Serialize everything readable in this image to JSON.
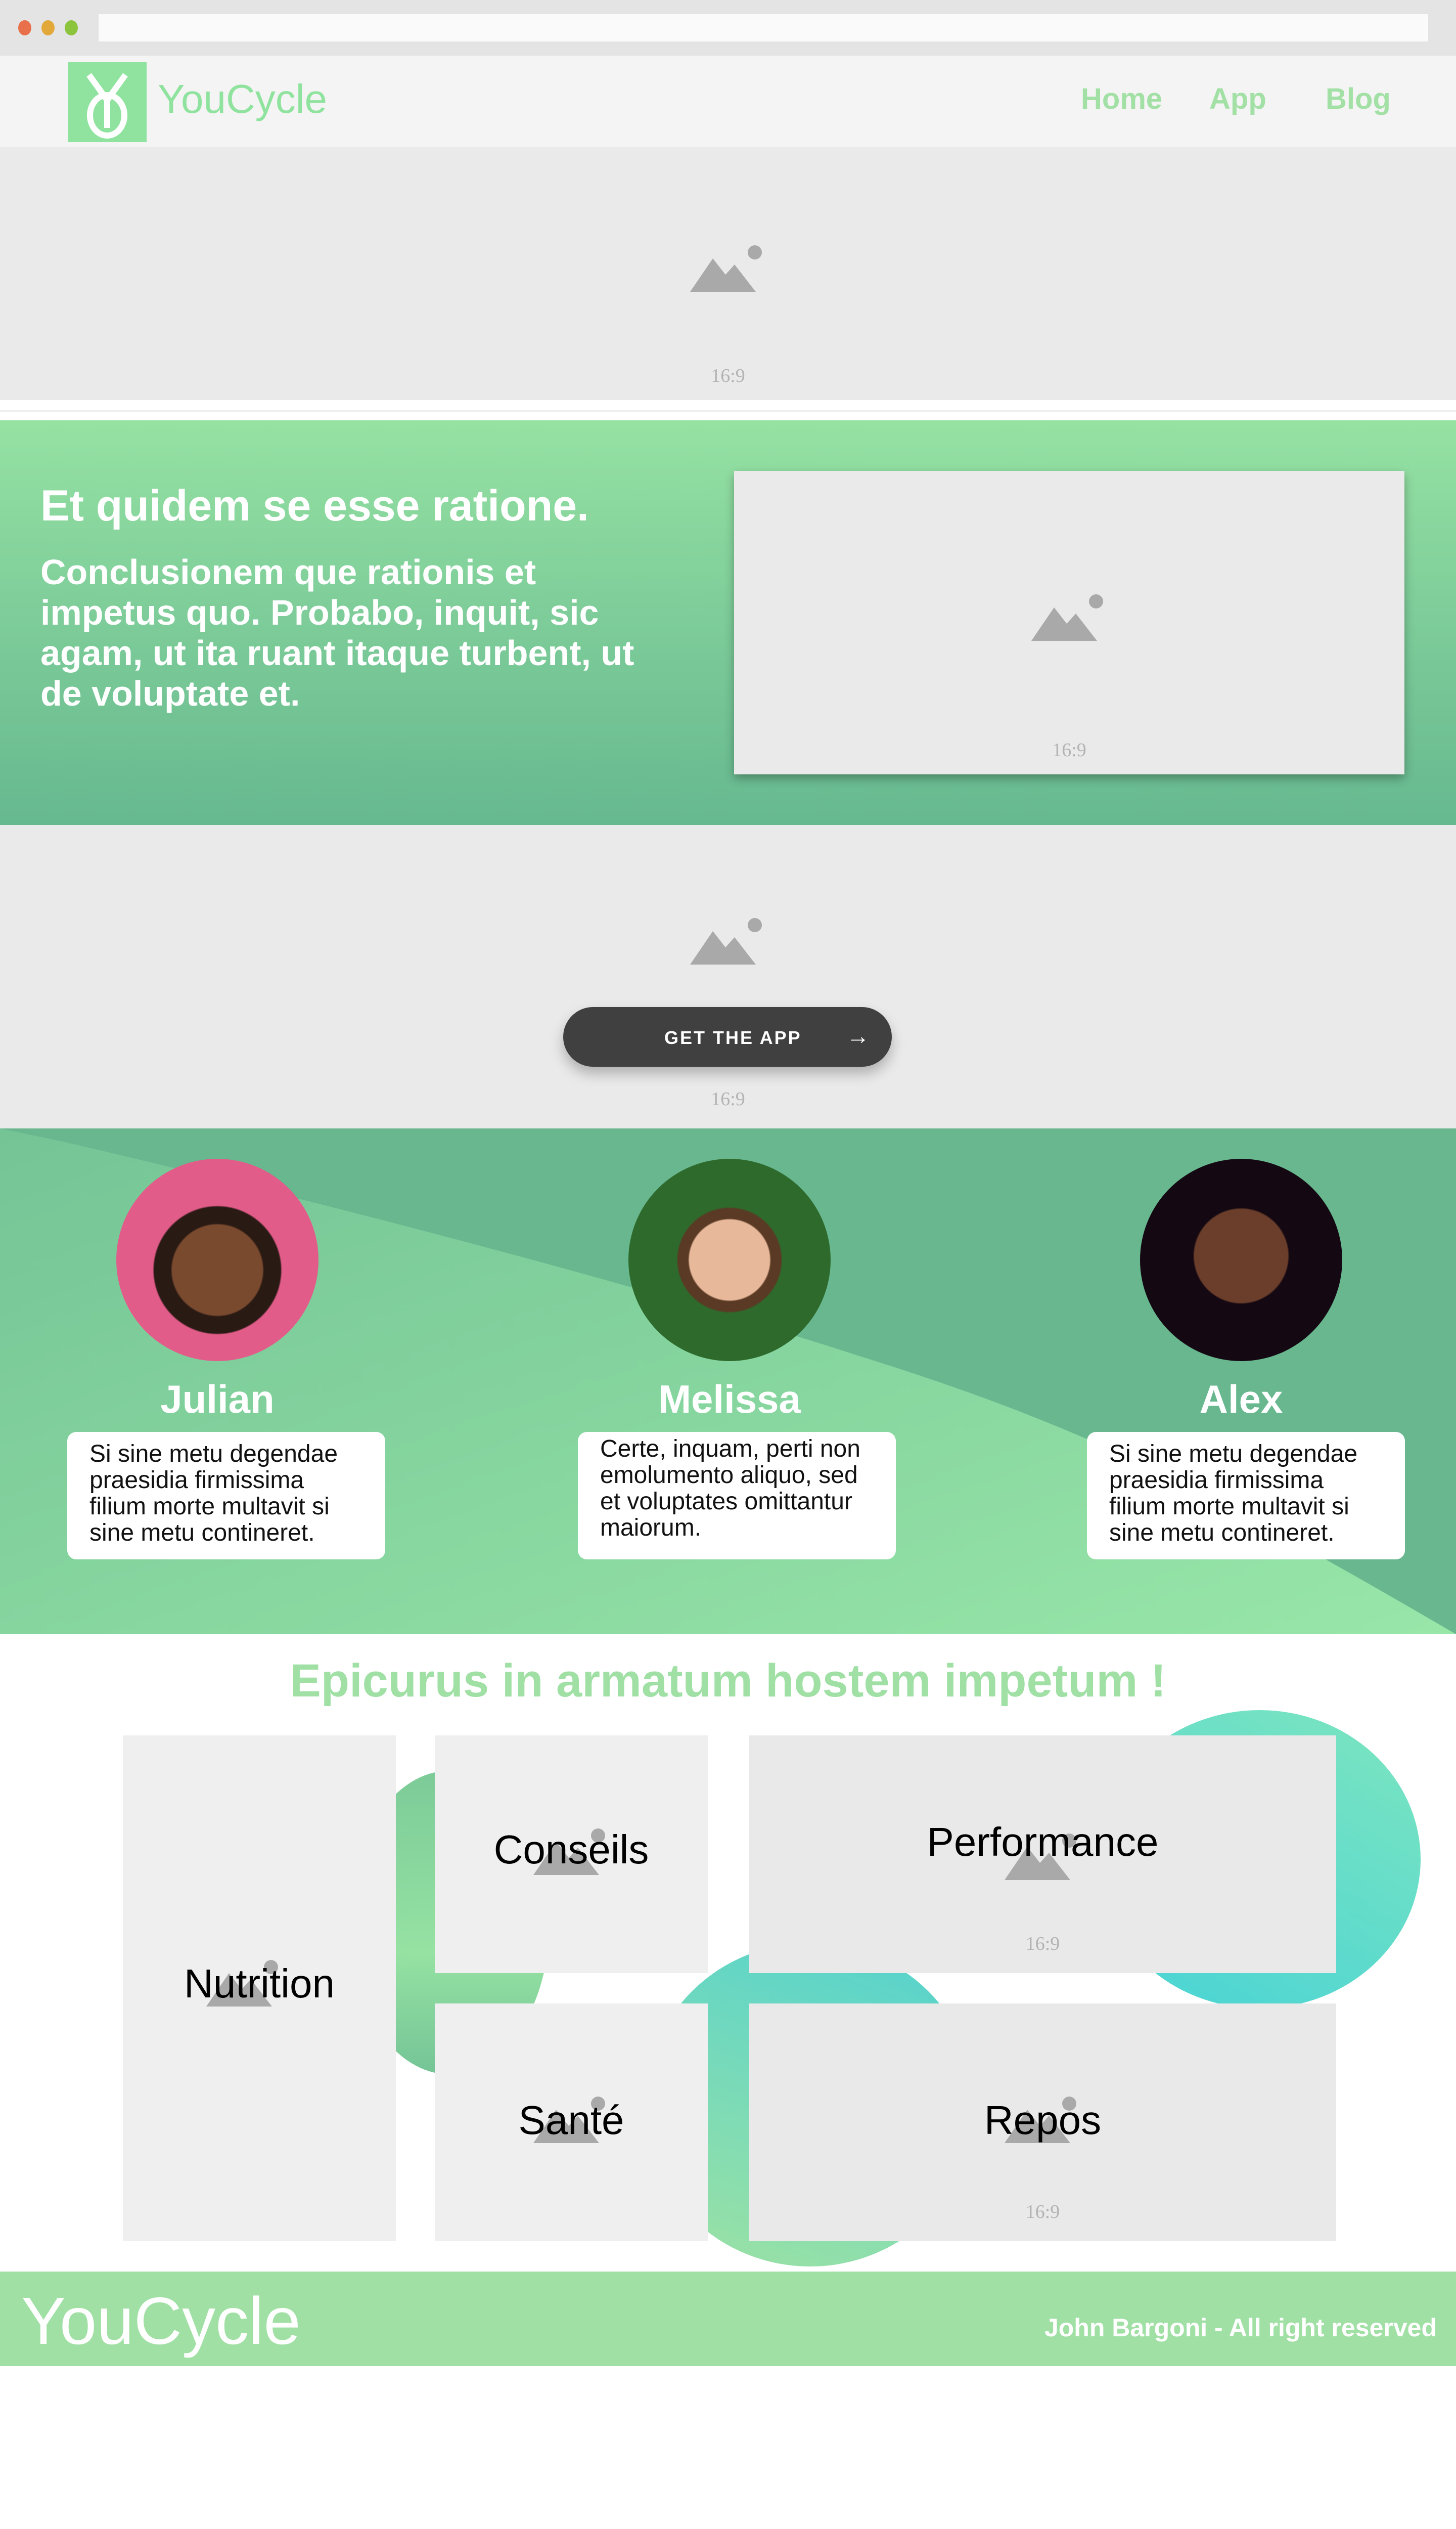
{
  "browser": {
    "dots": [
      "#e8704a",
      "#e2a83a",
      "#8cc43e"
    ]
  },
  "header": {
    "brand": "YouCycle",
    "nav": [
      "Home",
      "App",
      "Blog"
    ]
  },
  "hero": {
    "ratio_label": "16:9"
  },
  "intro": {
    "heading": "Et quidem se esse ratione.",
    "body": "Conclusionem que rationis et impetus quo. Probabo, inquit, sic agam, ut ita ruant itaque turbent, ut de voluptate et.",
    "ratio_label": "16:9"
  },
  "app": {
    "cta": "GET THE APP",
    "ratio_label": "16:9"
  },
  "testimonials": [
    {
      "name": "Julian",
      "text": "Si sine metu degendae praesidia firmissima filium morte multavit si sine metu contineret."
    },
    {
      "name": "Melissa",
      "text": "Certe, inquam, perti non emolumento aliquo, sed et voluptates omittantur maiorum."
    },
    {
      "name": "Alex",
      "text": "Si sine metu degendae praesidia firmissima filium morte multavit si sine metu contineret."
    }
  ],
  "features": {
    "title": "Epicurus in armatum hostem impetum !",
    "tiles": [
      "Nutrition",
      "Conseils",
      "Performance",
      "Santé",
      "Repos"
    ],
    "ratio_label": "16:9"
  },
  "footer": {
    "brand": "YouCycle",
    "copyright": "John Bargoni - All right reserved"
  },
  "colors": {
    "brand": "#90e39f",
    "dark_green": "#68b78f",
    "button": "#404040"
  }
}
